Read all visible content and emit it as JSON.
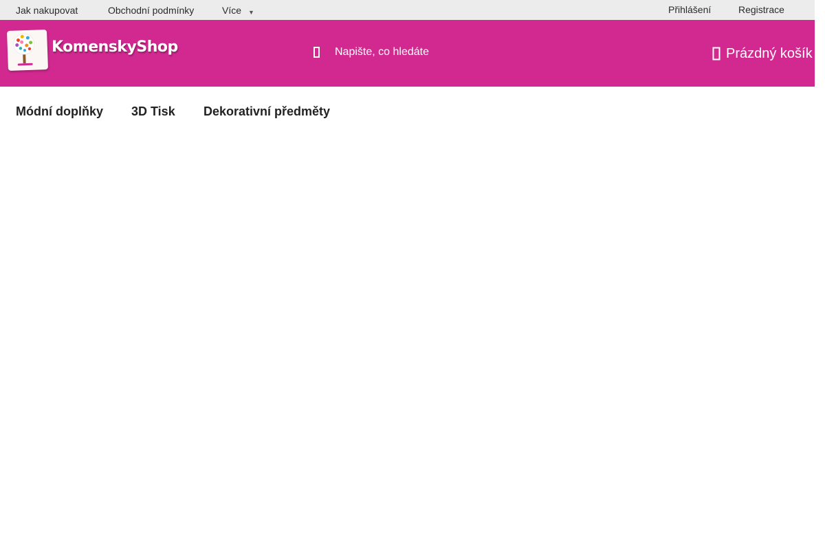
{
  "topbar": {
    "links": {
      "how_to_buy": "Jak nakupovat",
      "terms": "Obchodní podmínky",
      "more": "Více"
    },
    "more_caret_icon": "chevron-down-icon",
    "account": {
      "login": "Přihlášení",
      "register": "Registrace"
    }
  },
  "header": {
    "logo_text": "KomenskyShop",
    "search": {
      "placeholder": "Napište, co hledáte",
      "value": ""
    },
    "cart": {
      "label": "Prázdný košík"
    }
  },
  "menu": {
    "items": [
      {
        "label": "Módní doplňky"
      },
      {
        "label": "3D Tisk"
      },
      {
        "label": "Dekorativní předměty"
      }
    ]
  },
  "colors": {
    "brand": "#d22991",
    "topbar_bg": "#ececec",
    "text_dark": "#222222"
  },
  "icons": [
    "search-icon",
    "cart-icon",
    "chevron-down-icon",
    "logo-tree-icon"
  ]
}
